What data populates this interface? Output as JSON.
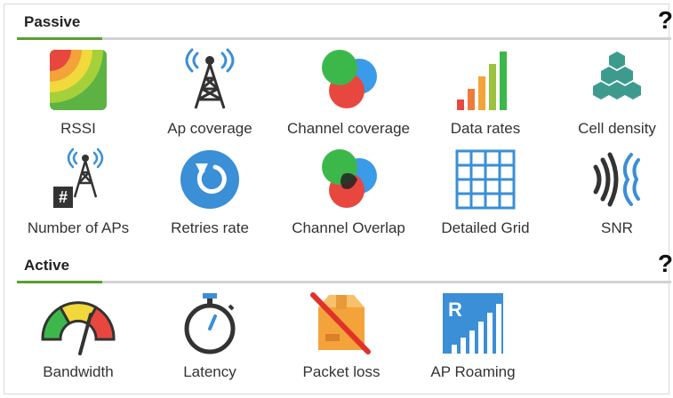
{
  "sections": {
    "passive": {
      "title": "Passive",
      "help_label": "?",
      "items": [
        {
          "label": "RSSI",
          "icon": "rssi-heatmap-icon"
        },
        {
          "label": "Ap coverage",
          "icon": "ap-tower-icon"
        },
        {
          "label": "Channel coverage",
          "icon": "channel-circles-icon"
        },
        {
          "label": "Data rates",
          "icon": "signal-bars-icon"
        },
        {
          "label": "Cell density",
          "icon": "hexagons-icon"
        },
        {
          "label": "Number of APs",
          "icon": "ap-count-icon",
          "badge": "#"
        },
        {
          "label": "Retries rate",
          "icon": "retry-icon"
        },
        {
          "label": "Channel Overlap",
          "icon": "channel-overlap-icon"
        },
        {
          "label": "Detailed Grid",
          "icon": "grid-icon"
        },
        {
          "label": "SNR",
          "icon": "snr-waves-icon"
        }
      ]
    },
    "active": {
      "title": "Active",
      "help_label": "?",
      "items": [
        {
          "label": "Bandwidth",
          "icon": "gauge-icon"
        },
        {
          "label": "Latency",
          "icon": "stopwatch-icon"
        },
        {
          "label": "Packet loss",
          "icon": "crossed-box-icon"
        },
        {
          "label": "AP Roaming",
          "icon": "roaming-icon",
          "badge": "R"
        }
      ]
    }
  },
  "colors": {
    "accent_green": "#5a9e2f",
    "divider_gray": "#d3d3d3",
    "blue": "#3a8fd6",
    "red": "#e8473f",
    "green": "#3cb84a",
    "orange": "#f3a33a",
    "teal": "#3d9b8e"
  }
}
